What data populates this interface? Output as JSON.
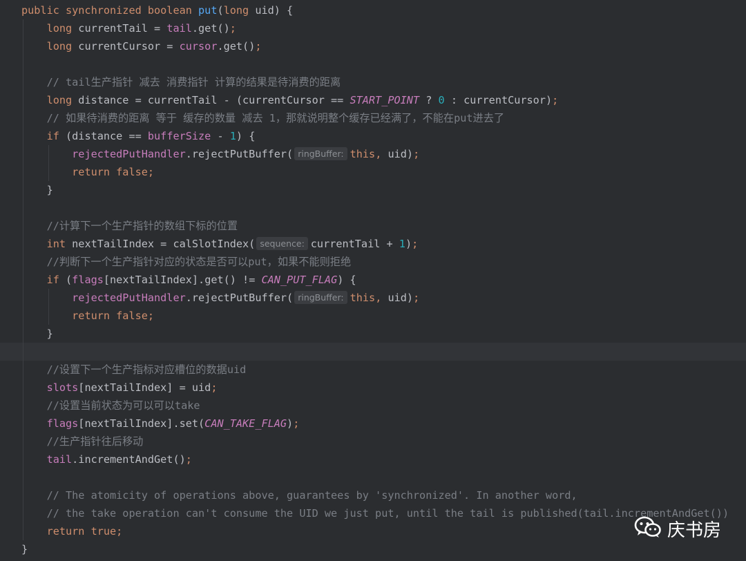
{
  "code_lines": [
    {
      "indent": 0,
      "tokens": [
        {
          "t": "public synchronized boolean ",
          "c": "kw"
        },
        {
          "t": "put",
          "c": "fn"
        },
        {
          "t": "("
        },
        {
          "t": "long ",
          "c": "kw"
        },
        {
          "t": "uid) {"
        }
      ]
    },
    {
      "indent": 1,
      "tokens": [
        {
          "t": "long ",
          "c": "kw"
        },
        {
          "t": "currentTail = "
        },
        {
          "t": "tail",
          "c": "fld"
        },
        {
          "t": ".get()"
        },
        {
          "t": ";",
          "c": "kw"
        }
      ]
    },
    {
      "indent": 1,
      "tokens": [
        {
          "t": "long ",
          "c": "kw"
        },
        {
          "t": "currentCursor = "
        },
        {
          "t": "cursor",
          "c": "fld"
        },
        {
          "t": ".get()"
        },
        {
          "t": ";",
          "c": "kw"
        }
      ]
    },
    {
      "indent": 1,
      "tokens": []
    },
    {
      "indent": 1,
      "tokens": [
        {
          "t": "// tail生产指针 减去 消费指针 计算的结果是待消费的距离",
          "c": "cm"
        }
      ]
    },
    {
      "indent": 1,
      "tokens": [
        {
          "t": "long ",
          "c": "kw"
        },
        {
          "t": "distance = currentTail - (currentCursor == "
        },
        {
          "t": "START_POINT",
          "c": "cst"
        },
        {
          "t": " ? "
        },
        {
          "t": "0",
          "c": "num"
        },
        {
          "t": " : currentCursor)"
        },
        {
          "t": ";",
          "c": "kw"
        }
      ]
    },
    {
      "indent": 1,
      "tokens": [
        {
          "t": "// 如果待消费的距离 等于 缓存的数量 减去 1，那就说明整个缓存已经满了，不能在put进去了",
          "c": "cm"
        }
      ]
    },
    {
      "indent": 1,
      "tokens": [
        {
          "t": "if ",
          "c": "kw"
        },
        {
          "t": "(distance == "
        },
        {
          "t": "bufferSize",
          "c": "fld"
        },
        {
          "t": " - "
        },
        {
          "t": "1",
          "c": "num"
        },
        {
          "t": ") {"
        }
      ]
    },
    {
      "indent": 2,
      "tokens": [
        {
          "t": "rejectedPutHandler",
          "c": "fld"
        },
        {
          "t": ".rejectPutBuffer("
        },
        {
          "hint": "ringBuffer:"
        },
        {
          "t": "this",
          "c": "kw"
        },
        {
          "t": ", ",
          "c": "kw"
        },
        {
          "t": "uid)"
        },
        {
          "t": ";",
          "c": "kw"
        }
      ]
    },
    {
      "indent": 2,
      "tokens": [
        {
          "t": "return false;",
          "c": "kw"
        }
      ]
    },
    {
      "indent": 1,
      "tokens": [
        {
          "t": "}"
        }
      ]
    },
    {
      "indent": 1,
      "tokens": []
    },
    {
      "indent": 1,
      "tokens": [
        {
          "t": "//计算下一个生产指针的数组下标的位置",
          "c": "cm"
        }
      ]
    },
    {
      "indent": 1,
      "tokens": [
        {
          "t": "int ",
          "c": "kw"
        },
        {
          "t": "nextTailIndex = calSlotIndex("
        },
        {
          "hint": "sequence:"
        },
        {
          "t": "currentTail + "
        },
        {
          "t": "1",
          "c": "num"
        },
        {
          "t": ")"
        },
        {
          "t": ";",
          "c": "kw"
        }
      ]
    },
    {
      "indent": 1,
      "tokens": [
        {
          "t": "//判断下一个生产指针对应的状态是否可以put，如果不能则拒绝",
          "c": "cm"
        }
      ]
    },
    {
      "indent": 1,
      "tokens": [
        {
          "t": "if ",
          "c": "kw"
        },
        {
          "t": "("
        },
        {
          "t": "flags",
          "c": "fld"
        },
        {
          "t": "[nextTailIndex].get() != "
        },
        {
          "t": "CAN_PUT_FLAG",
          "c": "cst"
        },
        {
          "t": ") {"
        }
      ]
    },
    {
      "indent": 2,
      "tokens": [
        {
          "t": "rejectedPutHandler",
          "c": "fld"
        },
        {
          "t": ".rejectPutBuffer("
        },
        {
          "hint": "ringBuffer:"
        },
        {
          "t": "this",
          "c": "kw"
        },
        {
          "t": ", ",
          "c": "kw"
        },
        {
          "t": "uid)"
        },
        {
          "t": ";",
          "c": "kw"
        }
      ]
    },
    {
      "indent": 2,
      "tokens": [
        {
          "t": "return false;",
          "c": "kw"
        }
      ]
    },
    {
      "indent": 1,
      "tokens": [
        {
          "t": "}"
        }
      ]
    },
    {
      "indent": 1,
      "tokens": [],
      "current": true
    },
    {
      "indent": 1,
      "tokens": [
        {
          "t": "//设置下一个生产指标对应槽位的数据uid",
          "c": "cm"
        }
      ]
    },
    {
      "indent": 1,
      "tokens": [
        {
          "t": "slots",
          "c": "fld"
        },
        {
          "t": "[nextTailIndex] = uid"
        },
        {
          "t": ";",
          "c": "kw"
        }
      ]
    },
    {
      "indent": 1,
      "tokens": [
        {
          "t": "//设置当前状态为可以可以take",
          "c": "cm"
        }
      ]
    },
    {
      "indent": 1,
      "tokens": [
        {
          "t": "flags",
          "c": "fld"
        },
        {
          "t": "[nextTailIndex].set("
        },
        {
          "t": "CAN_TAKE_FLAG",
          "c": "cst"
        },
        {
          "t": ")"
        },
        {
          "t": ";",
          "c": "kw"
        }
      ]
    },
    {
      "indent": 1,
      "tokens": [
        {
          "t": "//生产指针往后移动",
          "c": "cm"
        }
      ]
    },
    {
      "indent": 1,
      "tokens": [
        {
          "t": "tail",
          "c": "fld"
        },
        {
          "t": ".incrementAndGet()"
        },
        {
          "t": ";",
          "c": "kw"
        }
      ]
    },
    {
      "indent": 1,
      "tokens": []
    },
    {
      "indent": 1,
      "tokens": [
        {
          "t": "// The atomicity of operations above, guarantees by 'synchronized'. In another word,",
          "c": "cm"
        }
      ]
    },
    {
      "indent": 1,
      "tokens": [
        {
          "t": "// the take operation can't consume the UID we just put, until the tail is published(tail.incrementAndGet())",
          "c": "cm"
        }
      ]
    },
    {
      "indent": 1,
      "tokens": [
        {
          "t": "return true;",
          "c": "kw"
        }
      ]
    },
    {
      "indent": 0,
      "tokens": [
        {
          "t": "}"
        }
      ]
    }
  ],
  "watermark": {
    "label": "庆书房",
    "icon": "wechat-icon"
  },
  "colors": {
    "background": "#2b2d30",
    "keyword": "#cf8e6d",
    "field": "#c77dbb",
    "number": "#2aacb8",
    "method": "#56a8f5",
    "comment": "#7a7e85"
  }
}
